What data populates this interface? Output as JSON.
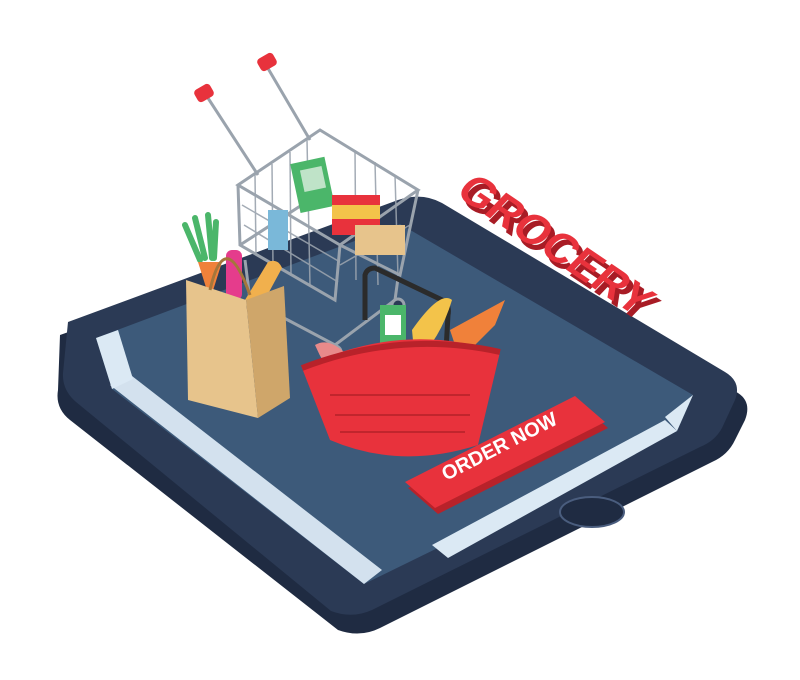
{
  "headline": {
    "text": "GROCERY",
    "color": "#e8323c"
  },
  "order_button": {
    "label": "ORDER NOW",
    "color": "#e8323c"
  },
  "colors": {
    "phone_body": "#2b3a55",
    "screen": "#3d5a7a",
    "screen_highlight": "#dbe9f4",
    "basket": "#e8323c",
    "bag": "#e7c48c",
    "cart_frame": "#9aa3ad"
  },
  "icons": [
    "smartphone-icon",
    "shopping-cart-icon",
    "shopping-basket-icon",
    "paper-bag-icon",
    "home-button-icon"
  ]
}
